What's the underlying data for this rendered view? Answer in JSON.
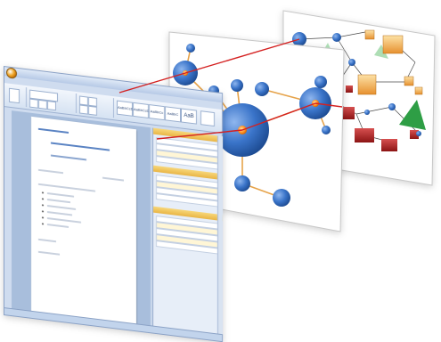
{
  "word": {
    "title": "",
    "tabs": [
      "",
      "",
      "",
      "",
      "",
      ""
    ],
    "style_gallery": [
      "AaBbCcDc",
      "AaBbCcDc",
      "AaBbCc",
      "AaBbC",
      "AaB"
    ],
    "doc_heading": "",
    "doc_subheading": ""
  },
  "colors": {
    "node_blue": "#3a74c9",
    "node_highlight": "#ff8c1a",
    "edge_orange": "#e6a34a",
    "link_red": "#d42020",
    "box_orange": "#f1b25a",
    "box_red": "#b52828",
    "triangle_green": "#3aa24a"
  },
  "icons": {
    "office_button": "office-orb-icon"
  }
}
